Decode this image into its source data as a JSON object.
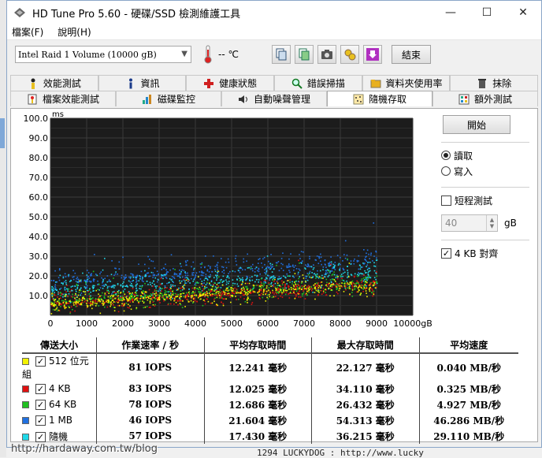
{
  "window": {
    "title": "HD Tune Pro 5.60 - 硬碟/SSD 檢測維護工具",
    "buttons": {
      "minimize": "—",
      "maximize": "☐",
      "close": "✕"
    }
  },
  "menu": {
    "items": [
      "檔案(F)",
      "說明(H)"
    ]
  },
  "toolbar": {
    "drive": "Intel  Raid 1 Volume (10000 gB)",
    "temperature": "-- ℃",
    "icons": [
      "copy-text-icon",
      "copy-screenshot-icon",
      "camera-icon",
      "options-icon",
      "download-icon"
    ],
    "exit_label": "結束"
  },
  "tabs_row1": [
    {
      "label": "效能測試",
      "icon": "benchmark-icon"
    },
    {
      "label": "資訊",
      "icon": "info-icon"
    },
    {
      "label": "健康狀態",
      "icon": "health-cross-icon"
    },
    {
      "label": "錯誤掃描",
      "icon": "magnifier-icon"
    },
    {
      "label": "資料夾使用率",
      "icon": "folder-icon"
    },
    {
      "label": "抹除",
      "icon": "trash-icon"
    }
  ],
  "tabs_row2": [
    {
      "label": "檔案效能測試",
      "icon": "file-benchmark-icon"
    },
    {
      "label": "磁碟監控",
      "icon": "monitor-chart-icon"
    },
    {
      "label": "自動噪聲管理",
      "icon": "speaker-icon"
    },
    {
      "label": "隨機存取",
      "icon": "random-access-icon",
      "active": true
    },
    {
      "label": "額外測試",
      "icon": "extra-tests-icon"
    }
  ],
  "controls": {
    "start_label": "開始",
    "read_label": "讀取",
    "write_label": "寫入",
    "mode_selected": "read",
    "short_test_label": "短程測試",
    "short_test_checked": false,
    "short_test_value": "40",
    "short_test_unit": "gB",
    "align_label": "4 KB 對齊",
    "align_checked": true
  },
  "results": {
    "headers": [
      "傳送大小",
      "作業速率 / 秒",
      "平均存取時間",
      "最大存取時間",
      "平均速度"
    ],
    "rows": [
      {
        "label": "512 位元組",
        "color": "#f2f200",
        "ops": "81 IOPS",
        "avg": "12.241 毫秒",
        "max": "22.127 毫秒",
        "speed": "0.040 MB/秒"
      },
      {
        "label": "4 KB",
        "color": "#e01010",
        "ops": "83 IOPS",
        "avg": "12.025 毫秒",
        "max": "34.110 毫秒",
        "speed": "0.325 MB/秒"
      },
      {
        "label": "64 KB",
        "color": "#20c020",
        "ops": "78 IOPS",
        "avg": "12.686 毫秒",
        "max": "26.432 毫秒",
        "speed": "4.927 MB/秒"
      },
      {
        "label": "1 MB",
        "color": "#2070e0",
        "ops": "46 IOPS",
        "avg": "21.604 毫秒",
        "max": "54.313 毫秒",
        "speed": "46.286 MB/秒"
      },
      {
        "label": "隨機",
        "color": "#20d8e8",
        "ops": "57 IOPS",
        "avg": "17.430 毫秒",
        "max": "36.215 毫秒",
        "speed": "29.110 MB/秒"
      }
    ]
  },
  "chart_data": {
    "type": "scatter",
    "ylabel": "ms",
    "xunit": "gB",
    "xlim": [
      0,
      10000
    ],
    "ylim": [
      0,
      100
    ],
    "xticks": [
      0,
      1000,
      2000,
      3000,
      4000,
      5000,
      6000,
      7000,
      8000,
      9000,
      10000
    ],
    "yticks": [
      "100.0",
      "90.0",
      "80.0",
      "70.0",
      "60.0",
      "50.0",
      "40.0",
      "30.0",
      "20.0",
      "10.0"
    ],
    "grid": true,
    "background": "#1c1c1c",
    "series": [
      {
        "name": "512 位元組",
        "color": "#f2f200",
        "y_start": 6,
        "y_end": 16,
        "spread": 7
      },
      {
        "name": "4 KB",
        "color": "#e01010",
        "y_start": 6,
        "y_end": 16,
        "spread": 7
      },
      {
        "name": "64 KB",
        "color": "#20c020",
        "y_start": 7,
        "y_end": 17,
        "spread": 7
      },
      {
        "name": "1 MB",
        "color": "#2070e0",
        "y_start": 17,
        "y_end": 28,
        "spread": 9
      },
      {
        "name": "隨機",
        "color": "#20d8e8",
        "y_start": 13,
        "y_end": 22,
        "spread": 9
      }
    ]
  },
  "watermark": "http://hardaway.com.tw/blog",
  "behind_text": "1294 LUCKYDOG : http://www.lucky"
}
